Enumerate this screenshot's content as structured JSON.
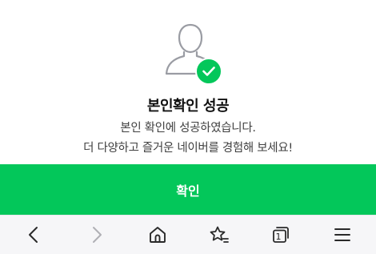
{
  "dialog": {
    "title": "본인확인 성공",
    "description_line1": "본인 확인에 성공하였습니다.",
    "description_line2": "더 다양하고 즐거운 네이버를 경험해 보세요!",
    "confirm_label": "확인"
  },
  "toolbar": {
    "items": [
      {
        "name": "back",
        "icon": "chevron-left-icon"
      },
      {
        "name": "forward",
        "icon": "chevron-right-icon",
        "disabled": true
      },
      {
        "name": "home",
        "icon": "home-icon"
      },
      {
        "name": "favorites",
        "icon": "star-list-icon"
      },
      {
        "name": "tabs",
        "icon": "tabs-icon",
        "count": "1"
      },
      {
        "name": "menu",
        "icon": "hamburger-icon"
      }
    ]
  },
  "colors": {
    "accent": "#03c75a",
    "title": "#111111",
    "text": "#404040",
    "icon_outline": "#9a9ca3",
    "toolbar_bg": "#f6f6f8"
  }
}
